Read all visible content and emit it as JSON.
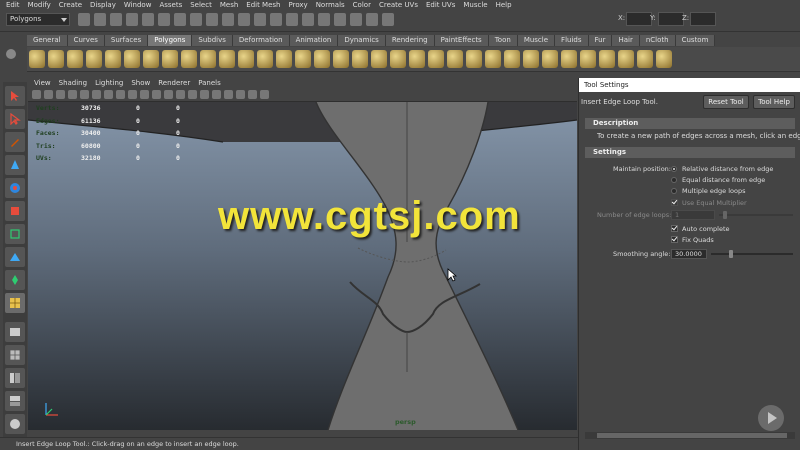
{
  "menubar": {
    "items": [
      "Edit",
      "Modify",
      "Create",
      "Display",
      "Window",
      "Assets",
      "Select",
      "Mesh",
      "Edit Mesh",
      "Proxy",
      "Normals",
      "Color",
      "Create UVs",
      "Edit UVs",
      "Muscle",
      "Help"
    ]
  },
  "statusline": {
    "mode": "Polygons",
    "x_label": "X:",
    "y_label": "Y:",
    "z_label": "Z:"
  },
  "shelf": {
    "tabs": [
      "General",
      "Curves",
      "Surfaces",
      "Polygons",
      "Subdivs",
      "Deformation",
      "Animation",
      "Dynamics",
      "Rendering",
      "PaintEffects",
      "Toon",
      "Muscle",
      "Fluids",
      "Fur",
      "Hair",
      "nCloth",
      "Custom"
    ],
    "active_tab": "Polygons"
  },
  "viewport": {
    "menu": [
      "View",
      "Shading",
      "Lighting",
      "Show",
      "Renderer",
      "Panels"
    ],
    "hud": [
      {
        "label": "Verts:",
        "v1": "30736",
        "v2": "0",
        "v3": "0"
      },
      {
        "label": "Edges:",
        "v1": "61136",
        "v2": "0",
        "v3": "0"
      },
      {
        "label": "Faces:",
        "v1": "30400",
        "v2": "0",
        "v3": "0"
      },
      {
        "label": "Tris:",
        "v1": "60800",
        "v2": "0",
        "v3": "0"
      },
      {
        "label": "UVs:",
        "v1": "32180",
        "v2": "0",
        "v3": "0"
      }
    ],
    "camera_label": "persp",
    "watermark": "www.cgtsj.com"
  },
  "tool_settings": {
    "window_title": "Tool Settings",
    "tool_name": "Insert Edge Loop Tool.",
    "reset_label": "Reset Tool",
    "help_label": "Tool Help",
    "description_header": "Description",
    "description_text": "To create a new path of edges across a mesh, click an edge and",
    "settings_header": "Settings",
    "maintain_position_label": "Maintain position:",
    "options": [
      "Relative distance from edge",
      "Equal distance from edge",
      "Multiple edge loops"
    ],
    "selected_option": "Relative distance from edge",
    "use_equal_multiplier": "Use Equal Multiplier",
    "edge_loops_label": "Number of edge loops:",
    "edge_loops_value": "1",
    "auto_complete": "Auto complete",
    "fix_quads": "Fix Quads",
    "smoothing_label": "Smoothing angle:",
    "smoothing_value": "30.0000"
  },
  "helpline": {
    "text": "Insert Edge Loop Tool.: Click-drag on an edge to insert an edge loop."
  },
  "colors": {
    "accent_yellow": "#f2e43a",
    "panel_bg": "#444444",
    "viewport_top": "#8697ab",
    "viewport_bottom": "#272b30"
  }
}
